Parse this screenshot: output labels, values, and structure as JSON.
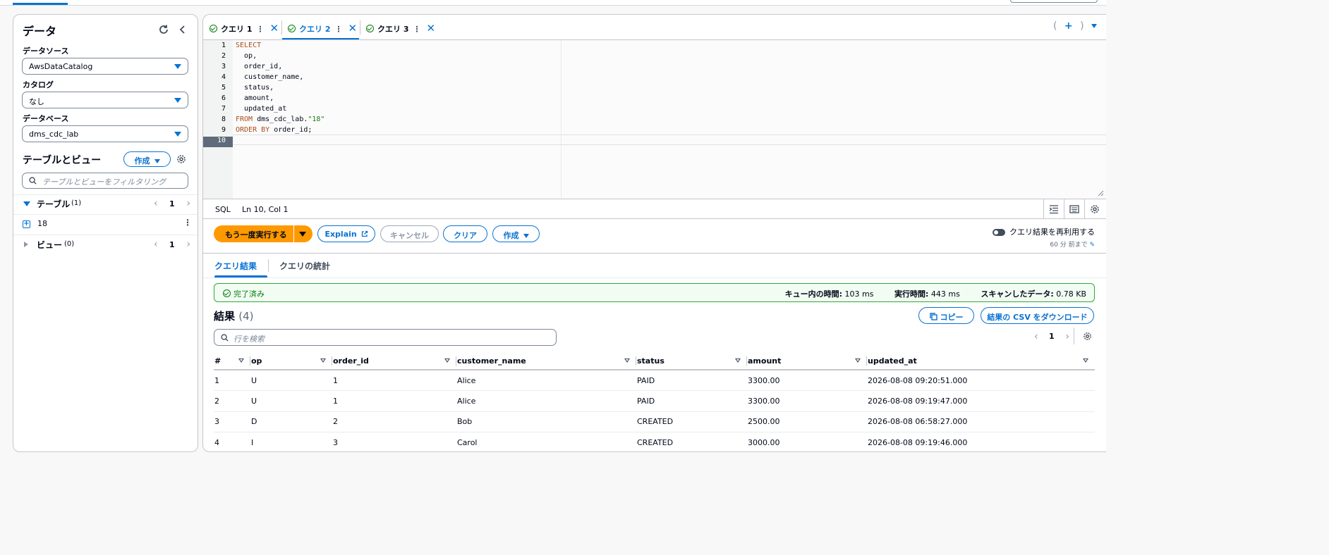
{
  "left": {
    "title": "データ",
    "datasource_label": "データソース",
    "datasource_value": "AwsDataCatalog",
    "catalog_label": "カタログ",
    "catalog_value": "なし",
    "database_label": "データベース",
    "database_value": "dms_cdc_lab",
    "tables_views_title": "テーブルとビュー",
    "create_label": "作成",
    "filter_placeholder": "テーブルとビューをフィルタリング",
    "tables_label": "テーブル",
    "tables_count": "(1)",
    "tables_page": "1",
    "table_item": "18",
    "views_label": "ビュー",
    "views_count": "(0)",
    "views_page": "1"
  },
  "tabs": [
    {
      "label": "クエリ 1"
    },
    {
      "label": "クエリ 2"
    },
    {
      "label": "クエリ 3"
    }
  ],
  "editor": {
    "lines": [
      {
        "n": "1",
        "html": "<span class='kw'>SELECT</span>"
      },
      {
        "n": "2",
        "html": "  op,"
      },
      {
        "n": "3",
        "html": "  order_id,"
      },
      {
        "n": "4",
        "html": "  customer_name,"
      },
      {
        "n": "5",
        "html": "  status,"
      },
      {
        "n": "6",
        "html": "  amount,"
      },
      {
        "n": "7",
        "html": "  updated_at"
      },
      {
        "n": "8",
        "html": "<span class='kw'>FROM</span> dms_cdc_lab.<span class='str'>\"18\"</span>"
      },
      {
        "n": "9",
        "html": "<span class='kw'>ORDER BY</span> order_id;"
      },
      {
        "n": "10",
        "html": ""
      }
    ],
    "mode": "SQL",
    "position": "Ln 10, Col 1"
  },
  "actions": {
    "run_again": "もう一度実行する",
    "explain": "Explain",
    "cancel": "キャンセル",
    "clear": "クリア",
    "create": "作成",
    "reuse_label": "クエリ結果を再利用する",
    "reuse_sub": "60 分 前まで"
  },
  "result_tabs": {
    "results": "クエリ結果",
    "stats": "クエリの統計"
  },
  "status": {
    "text": "完了済み",
    "queue_label": "キュー内の時間:",
    "queue_value": "103 ms",
    "run_label": "実行時間:",
    "run_value": "443 ms",
    "scan_label": "スキャンしたデータ:",
    "scan_value": "0.78 KB"
  },
  "results": {
    "title": "結果",
    "count": "(4)",
    "copy": "コピー",
    "download": "結果の CSV をダウンロード",
    "search_placeholder": "行を検索",
    "page": "1",
    "columns": [
      "#",
      "op",
      "order_id",
      "customer_name",
      "status",
      "amount",
      "updated_at"
    ],
    "rows": [
      [
        "1",
        "U",
        "1",
        "Alice",
        "PAID",
        "3300.00",
        "2026-08-08 09:20:51.000"
      ],
      [
        "2",
        "U",
        "1",
        "Alice",
        "PAID",
        "3300.00",
        "2026-08-08 09:19:47.000"
      ],
      [
        "3",
        "D",
        "2",
        "Bob",
        "CREATED",
        "2500.00",
        "2026-08-08 06:58:27.000"
      ],
      [
        "4",
        "I",
        "3",
        "Carol",
        "CREATED",
        "3000.00",
        "2026-08-08 09:19:46.000"
      ]
    ]
  },
  "colors": {
    "accent": "#0972d3",
    "primary": "#ff9900",
    "success": "#037f0c"
  }
}
